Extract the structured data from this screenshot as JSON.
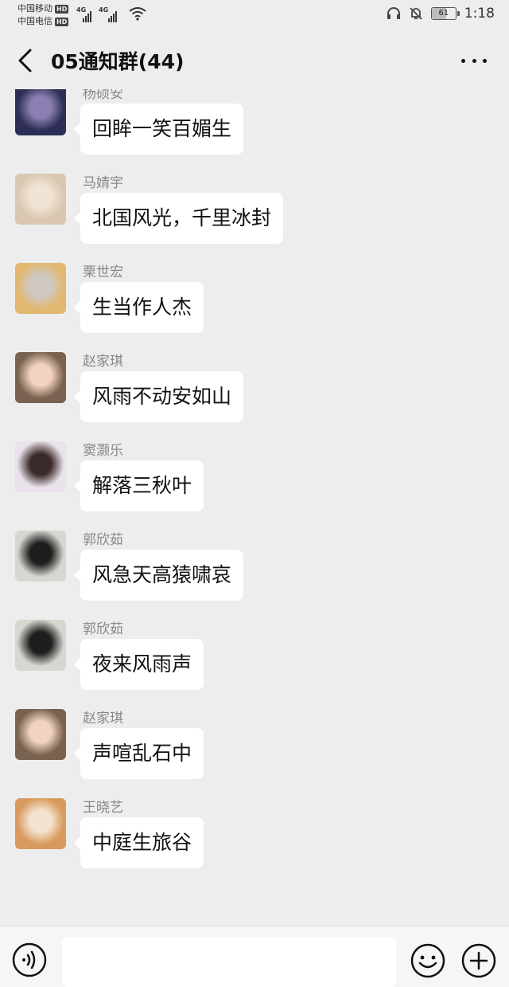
{
  "status_bar": {
    "carrier1": "中国移动",
    "carrier2": "中国电信",
    "hd1": "HD",
    "hd2": "HD",
    "net1": "4G",
    "net2": "4G",
    "battery": "61",
    "battery_level": 0.61,
    "time": "1:18"
  },
  "header": {
    "title": "05通知群(44)"
  },
  "messages": [
    {
      "sender": "",
      "text": "回眸一笑百媚生",
      "avatar_bg": "#3a3340",
      "avatar_accent": "#e8dcd6"
    },
    {
      "sender": "杨硕安",
      "text": "回眸一笑百媚生",
      "avatar_bg": "#2c2e55",
      "avatar_accent": "#8a7fb0"
    },
    {
      "sender": "马婧宇",
      "text": "北国风光，千里冰封",
      "avatar_bg": "#d9c7b2",
      "avatar_accent": "#f1e4d4"
    },
    {
      "sender": "栗世宏",
      "text": "生当作人杰",
      "avatar_bg": "#e2b870",
      "avatar_accent": "#cfc9c2"
    },
    {
      "sender": "赵家琪",
      "text": "风雨不动安如山",
      "avatar_bg": "#7a6250",
      "avatar_accent": "#f2d2c0"
    },
    {
      "sender": "窦灏乐",
      "text": "解落三秋叶",
      "avatar_bg": "#e9e2ea",
      "avatar_accent": "#3b2a2a"
    },
    {
      "sender": "郭欣茹",
      "text": "风急天高猿啸哀",
      "avatar_bg": "#d7d7d2",
      "avatar_accent": "#1e1e1e"
    },
    {
      "sender": "郭欣茹",
      "text": "夜来风雨声",
      "avatar_bg": "#d7d7d2",
      "avatar_accent": "#1e1e1e"
    },
    {
      "sender": "赵家琪",
      "text": "声喧乱石中",
      "avatar_bg": "#7a6250",
      "avatar_accent": "#f2d2c0"
    },
    {
      "sender": "王晓艺",
      "text": "中庭生旅谷",
      "avatar_bg": "#d99a5e",
      "avatar_accent": "#f4e3d0"
    }
  ],
  "input": {
    "value": "",
    "placeholder": ""
  },
  "colors": {
    "background": "#ededed",
    "bubble": "#ffffff",
    "sender_name": "#888888"
  },
  "icons": {
    "back": "chevron-left-icon",
    "more": "more-dots-icon",
    "voice": "voice-icon",
    "emoji": "emoji-icon",
    "plus": "plus-icon"
  }
}
